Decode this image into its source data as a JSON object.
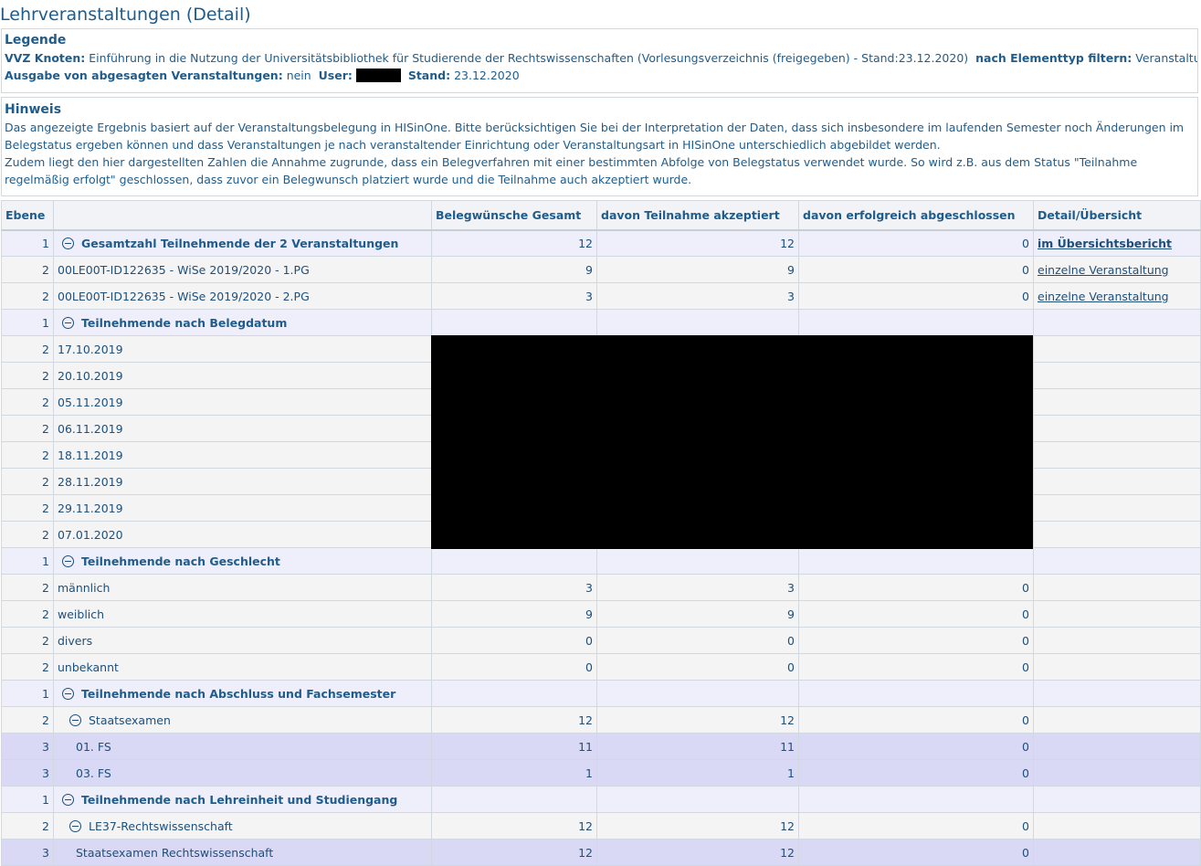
{
  "page_title": "Lehrveranstaltungen (Detail)",
  "legend": {
    "title": "Legende",
    "vvz_label": "VVZ Knoten:",
    "vvz_value": "Einführung in die Nutzung der Universitätsbibliothek für Studierende der Rechtswissenschaften (Vorlesungsverzeichnis (freigegeben) - Stand:23.12.2020)",
    "filter_label": "nach Elementtyp filtern:",
    "filter_value": "Veranstaltungen",
    "cancelled_label": "Ausgabe von abgesagten Veranstaltungen:",
    "cancelled_value": "nein",
    "user_label": "User:",
    "stand_label": "Stand:",
    "stand_value": "23.12.2020"
  },
  "hint": {
    "title": "Hinweis",
    "p1": "Das angezeigte Ergebnis basiert auf der Veranstaltungsbelegung in HISinOne. Bitte berücksichtigen Sie bei der Interpretation der Daten, dass sich insbesondere im laufenden Semester noch Änderungen im Belegstatus ergeben können und dass Veranstaltungen je nach veranstaltender Einrichtung oder Veranstaltungsart in HISinOne unterschiedlich abgebildet werden.",
    "p2": "Zudem liegt den hier dargestellten Zahlen die Annahme zugrunde, dass ein Belegverfahren mit einer bestimmten Abfolge von Belegstatus verwendet wurde. So wird z.B. aus dem Status \"Teilnahme regelmäßig erfolgt\" geschlossen, dass zuvor ein Belegwunsch platziert wurde und die Teilnahme auch akzeptiert wurde."
  },
  "table": {
    "headers": [
      "Ebene",
      "",
      "Belegwünsche Gesamt",
      "davon Teilnahme akzeptiert",
      "davon erfolgreich abgeschlossen",
      "Detail/Übersicht"
    ],
    "rows": [
      {
        "level": "1",
        "label": "Gesamtzahl Teilnehmende der 2 Veranstaltungen",
        "c1": "12",
        "c2": "12",
        "c3": "0",
        "link": "im Übersichtsbericht"
      },
      {
        "level": "2",
        "label": "00LE00T-ID122635 - WiSe 2019/2020 - 1.PG",
        "c1": "9",
        "c2": "9",
        "c3": "0",
        "link": "einzelne Veranstaltung"
      },
      {
        "level": "2",
        "label": "00LE00T-ID122635 - WiSe 2019/2020 - 2.PG",
        "c1": "3",
        "c2": "3",
        "c3": "0",
        "link": "einzelne Veranstaltung"
      },
      {
        "level": "1",
        "label": "Teilnehmende nach Belegdatum",
        "c1": "",
        "c2": "",
        "c3": "",
        "link": ""
      },
      {
        "level": "2",
        "label": "17.10.2019",
        "c1": "",
        "c2": "",
        "c3": "",
        "link": ""
      },
      {
        "level": "2",
        "label": "20.10.2019",
        "c1": "",
        "c2": "",
        "c3": "",
        "link": ""
      },
      {
        "level": "2",
        "label": "05.11.2019",
        "c1": "",
        "c2": "",
        "c3": "",
        "link": ""
      },
      {
        "level": "2",
        "label": "06.11.2019",
        "c1": "",
        "c2": "",
        "c3": "",
        "link": ""
      },
      {
        "level": "2",
        "label": "18.11.2019",
        "c1": "",
        "c2": "",
        "c3": "",
        "link": ""
      },
      {
        "level": "2",
        "label": "28.11.2019",
        "c1": "",
        "c2": "",
        "c3": "",
        "link": ""
      },
      {
        "level": "2",
        "label": "29.11.2019",
        "c1": "",
        "c2": "",
        "c3": "",
        "link": ""
      },
      {
        "level": "2",
        "label": "07.01.2020",
        "c1": "",
        "c2": "",
        "c3": "",
        "link": ""
      },
      {
        "level": "1",
        "label": "Teilnehmende nach Geschlecht",
        "c1": "",
        "c2": "",
        "c3": "",
        "link": ""
      },
      {
        "level": "2",
        "label": "männlich",
        "c1": "3",
        "c2": "3",
        "c3": "0",
        "link": ""
      },
      {
        "level": "2",
        "label": "weiblich",
        "c1": "9",
        "c2": "9",
        "c3": "0",
        "link": ""
      },
      {
        "level": "2",
        "label": "divers",
        "c1": "0",
        "c2": "0",
        "c3": "0",
        "link": ""
      },
      {
        "level": "2",
        "label": "unbekannt",
        "c1": "0",
        "c2": "0",
        "c3": "0",
        "link": ""
      },
      {
        "level": "1",
        "label": "Teilnehmende nach Abschluss und Fachsemester",
        "c1": "",
        "c2": "",
        "c3": "",
        "link": ""
      },
      {
        "level": "2",
        "label": "Staatsexamen",
        "c1": "12",
        "c2": "12",
        "c3": "0",
        "link": ""
      },
      {
        "level": "3",
        "label": "01. FS",
        "c1": "11",
        "c2": "11",
        "c3": "0",
        "link": ""
      },
      {
        "level": "3",
        "label": "03. FS",
        "c1": "1",
        "c2": "1",
        "c3": "0",
        "link": ""
      },
      {
        "level": "1",
        "label": "Teilnehmende nach Lehreinheit und Studiengang",
        "c1": "",
        "c2": "",
        "c3": "",
        "link": ""
      },
      {
        "level": "2",
        "label": "LE37-Rechtswissenschaft",
        "c1": "12",
        "c2": "12",
        "c3": "0",
        "link": ""
      },
      {
        "level": "3",
        "label": "Staatsexamen Rechtswissenschaft",
        "c1": "12",
        "c2": "12",
        "c3": "0",
        "link": ""
      }
    ]
  }
}
